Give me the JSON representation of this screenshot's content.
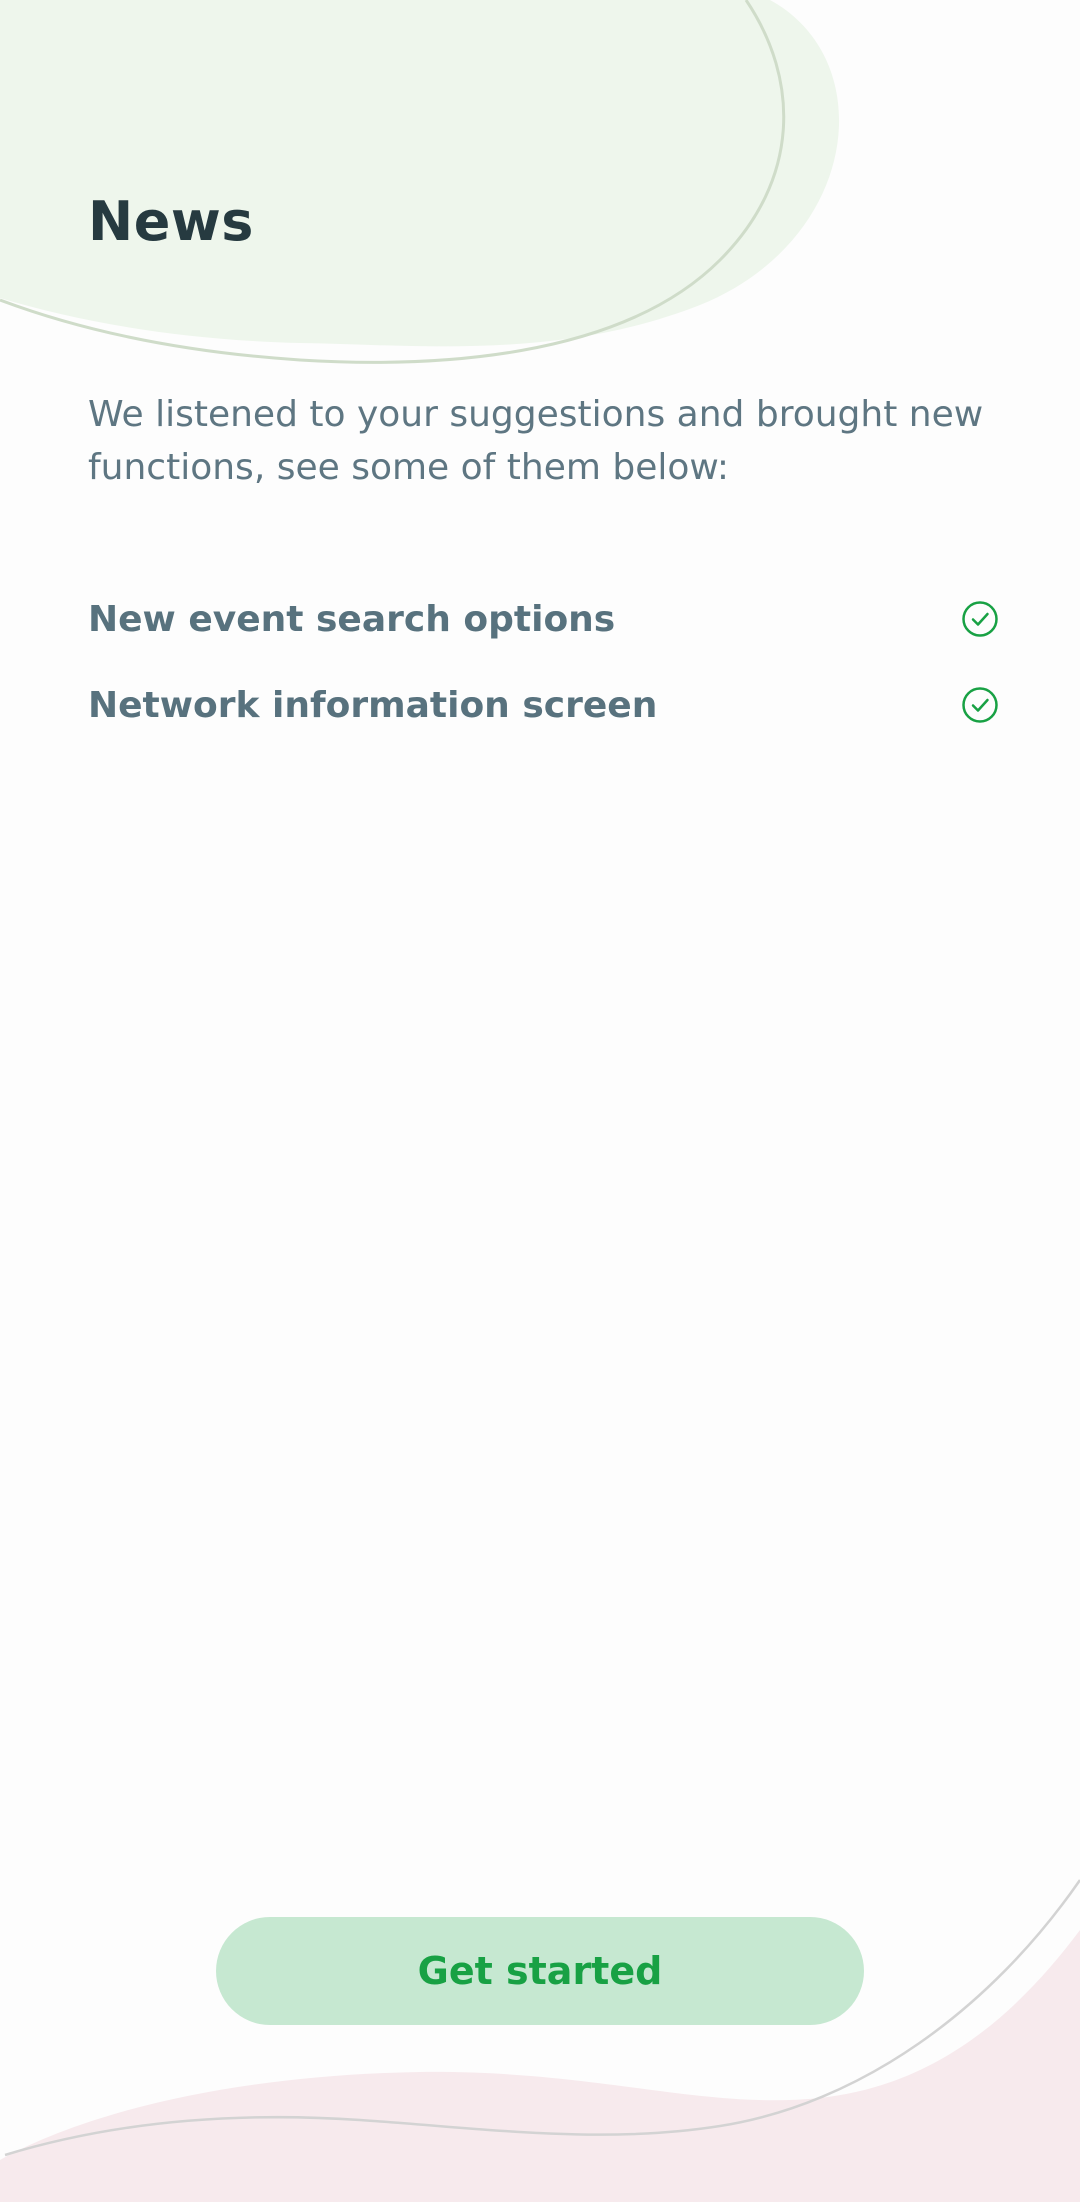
{
  "header": {
    "title": "News"
  },
  "intro": {
    "text": "We listened to your suggestions and brought new functions, see some of them below:"
  },
  "features": [
    {
      "label": "New event search options",
      "icon": "check-circle-icon",
      "status": "checked"
    },
    {
      "label": "Network information screen",
      "icon": "check-circle-icon",
      "status": "checked"
    }
  ],
  "footer": {
    "button_label": "Get started"
  },
  "colors": {
    "title": "#263a40",
    "body_text": "#5e7682",
    "accent_green": "#18a144",
    "button_bg": "#c6e8d1",
    "top_blob": "#eef6ec",
    "bottom_blob": "#f7eaed"
  }
}
